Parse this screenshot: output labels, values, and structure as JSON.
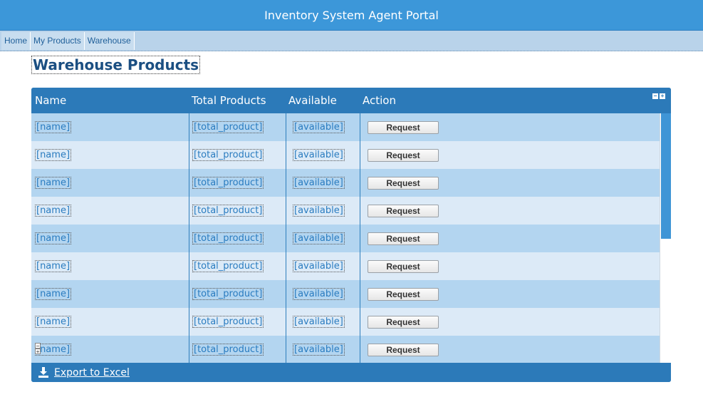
{
  "header": {
    "title": "Inventory System Agent Portal"
  },
  "nav": {
    "items": [
      {
        "label": "Home"
      },
      {
        "label": "My Products"
      },
      {
        "label": "Warehouse"
      }
    ]
  },
  "page": {
    "title": "Warehouse Products"
  },
  "grid": {
    "columns": [
      "Name",
      "Total Products",
      "Available",
      "Action"
    ],
    "controls": {
      "collapse": "−",
      "expand": "+"
    },
    "rows": [
      {
        "name": "[name]",
        "total": "[total_product]",
        "available": "[available]",
        "action": "Request"
      },
      {
        "name": "[name]",
        "total": "[total_product]",
        "available": "[available]",
        "action": "Request"
      },
      {
        "name": "[name]",
        "total": "[total_product]",
        "available": "[available]",
        "action": "Request"
      },
      {
        "name": "[name]",
        "total": "[total_product]",
        "available": "[available]",
        "action": "Request"
      },
      {
        "name": "[name]",
        "total": "[total_product]",
        "available": "[available]",
        "action": "Request"
      },
      {
        "name": "[name]",
        "total": "[total_product]",
        "available": "[available]",
        "action": "Request"
      },
      {
        "name": "[name]",
        "total": "[total_product]",
        "available": "[available]",
        "action": "Request"
      },
      {
        "name": "[name]",
        "total": "[total_product]",
        "available": "[available]",
        "action": "Request"
      },
      {
        "name": "[name]",
        "total": "[total_product]",
        "available": "[available]",
        "action": "Request"
      }
    ],
    "footer": {
      "export_label": "Export to Excel",
      "export_icon": "download-icon"
    }
  },
  "colors": {
    "header_bg": "#3c97d9",
    "grid_bg": "#2c7ab9",
    "row_odd": "#b3d5f0",
    "row_even": "#dceaf7"
  }
}
